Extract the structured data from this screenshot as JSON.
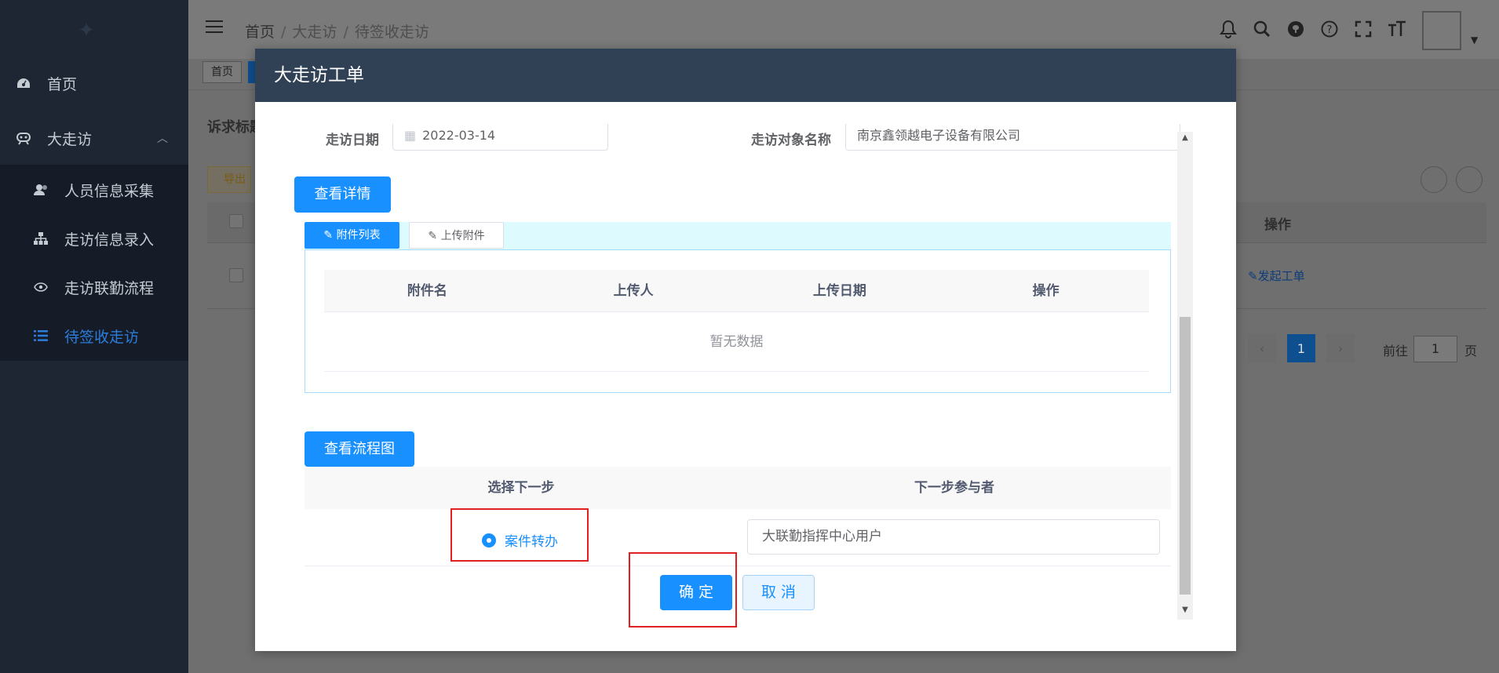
{
  "sidebar": {
    "items": [
      {
        "label": "首页",
        "icon": "dashboard-icon"
      },
      {
        "label": "大走访",
        "icon": "visit-icon"
      },
      {
        "label": "人员信息采集",
        "icon": "users-icon"
      },
      {
        "label": "走访信息录入",
        "icon": "tree-icon"
      },
      {
        "label": "走访联勤流程",
        "icon": "eye-icon"
      },
      {
        "label": "待签收走访",
        "icon": "list-icon"
      }
    ]
  },
  "header": {
    "breadcrumb": [
      "首页",
      "大走访",
      "待签收走访"
    ],
    "tags": {
      "home": "首页"
    }
  },
  "background_page": {
    "search_label": "诉求标题",
    "export_button": "导出",
    "column_operation": "操作",
    "row_action": "发起工单",
    "pagination": {
      "current": "1",
      "goto_label": "前往",
      "goto_value": "1",
      "page_suffix": "页"
    }
  },
  "modal": {
    "title": "大走访工单",
    "visit_date_label": "走访日期",
    "visit_date_value": "2022-03-14",
    "target_name_label": "走访对象名称",
    "target_name_value": "南京鑫领越电子设备有限公司",
    "view_details_button": "查看详情",
    "tabs": [
      "附件列表",
      "上传附件"
    ],
    "attachment_columns": [
      "附件名",
      "上传人",
      "上传日期",
      "操作"
    ],
    "attachment_empty": "暂无数据",
    "view_flowchart_button": "查看流程图",
    "step_columns": [
      "选择下一步",
      "下一步参与者"
    ],
    "next_step_option": "案件转办",
    "participant_value": "大联勤指挥中心用户",
    "confirm_button": "确 定",
    "cancel_button": "取 消"
  },
  "colors": {
    "primary": "#1890ff",
    "modal_header": "#304156",
    "sidebar": "#1e2633",
    "highlight_box": "#e02020"
  }
}
